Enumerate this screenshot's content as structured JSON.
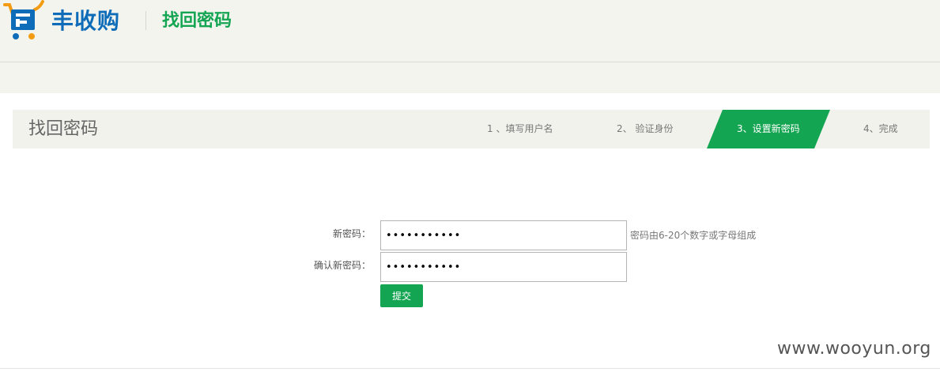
{
  "header": {
    "brand_name": "丰收购",
    "title": "找回密码",
    "logo_icon": "shopping-cart-logo-icon",
    "colors": {
      "brand": "#0f6cb8",
      "accent": "#14a552",
      "logo_orange": "#f39c12"
    }
  },
  "steps": {
    "title": "找回密码",
    "items": [
      {
        "label": "1 、填写用户名",
        "active": false
      },
      {
        "label": "2、 验证身份",
        "active": false
      },
      {
        "label": "3、设置新密码",
        "active": true
      },
      {
        "label": "4、完成",
        "active": false
      }
    ],
    "active_color": "#14a552"
  },
  "form": {
    "new_password": {
      "label": "新密码：",
      "value": "•••••••••••"
    },
    "confirm_password": {
      "label": "确认新密码：",
      "value": "•••••••••••"
    },
    "hint": "密码由6-20个数字或字母组成",
    "submit_label": "提交"
  },
  "watermark": "www.wooyun.org"
}
